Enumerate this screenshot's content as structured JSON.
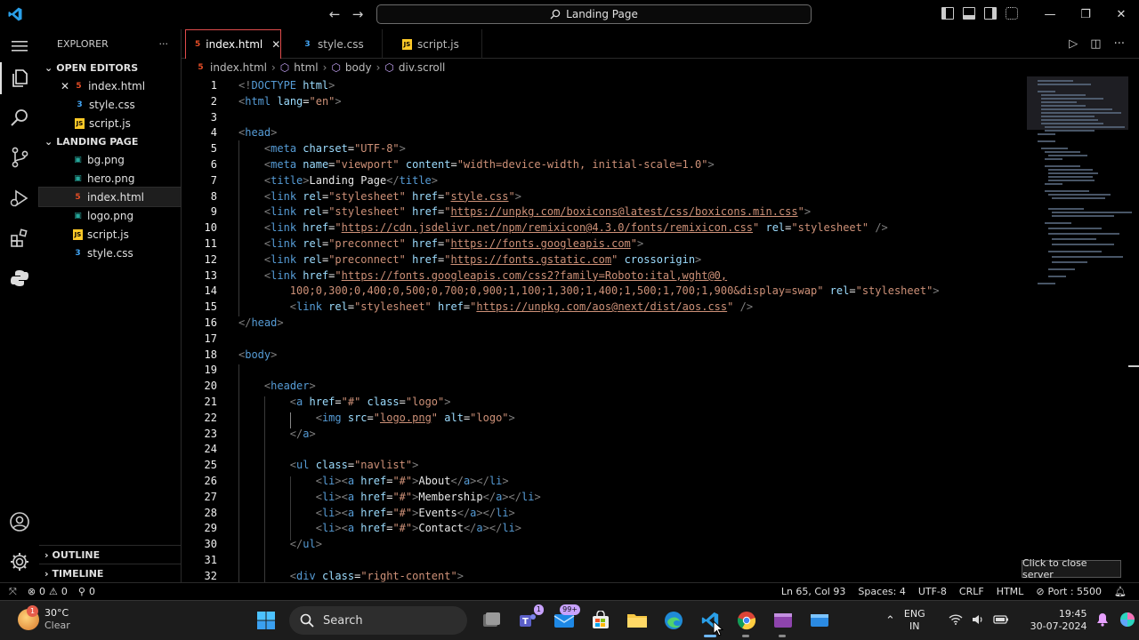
{
  "title_bar": {
    "search_text": "Landing Page",
    "nav_back": "←",
    "nav_forward": "→",
    "window_minimize": "—",
    "window_restore": "❐",
    "window_close": "✕"
  },
  "sidebar": {
    "header": "EXPLORER",
    "more": "···",
    "open_editors_label": "OPEN EDITORS",
    "open_editors": [
      {
        "name": "index.html",
        "type": "html"
      },
      {
        "name": "style.css",
        "type": "css"
      },
      {
        "name": "script.js",
        "type": "js"
      }
    ],
    "folder_label": "LANDING PAGE",
    "files": [
      {
        "name": "bg.png",
        "type": "png"
      },
      {
        "name": "hero.png",
        "type": "png"
      },
      {
        "name": "index.html",
        "type": "html"
      },
      {
        "name": "logo.png",
        "type": "png"
      },
      {
        "name": "script.js",
        "type": "js"
      },
      {
        "name": "style.css",
        "type": "css"
      }
    ],
    "outline_label": "OUTLINE",
    "timeline_label": "TIMELINE"
  },
  "tabs": [
    {
      "name": "index.html",
      "type": "html"
    },
    {
      "name": "style.css",
      "type": "css"
    },
    {
      "name": "script.js",
      "type": "js"
    }
  ],
  "breadcrumb": [
    "index.html",
    "html",
    "body",
    "div.scroll"
  ],
  "editor": {
    "line_numbers": [
      "1",
      "2",
      "3",
      "4",
      "5",
      "6",
      "7",
      "8",
      "9",
      "10",
      "11",
      "12",
      "13",
      "14",
      "15",
      "16",
      "17",
      "18",
      "19",
      "20",
      "21",
      "22",
      "23",
      "24",
      "25",
      "26",
      "27",
      "28",
      "29",
      "30",
      "31",
      "32"
    ]
  },
  "tooltip": "Click to close server",
  "status_bar": {
    "errors": "0",
    "warnings": "0",
    "ports": "0",
    "position": "Ln 65, Col 93",
    "spaces": "Spaces: 4",
    "encoding": "UTF-8",
    "eol": "CRLF",
    "language": "HTML",
    "port": "Port : 5500"
  },
  "taskbar": {
    "weather_temp": "30°C",
    "weather_desc": "Clear",
    "weather_badge": "1",
    "search_label": "Search",
    "mail_badge": "99+",
    "teams_badge": "1",
    "lang_line1": "ENG",
    "lang_line2": "IN",
    "time": "19:45",
    "date": "30-07-2024"
  }
}
